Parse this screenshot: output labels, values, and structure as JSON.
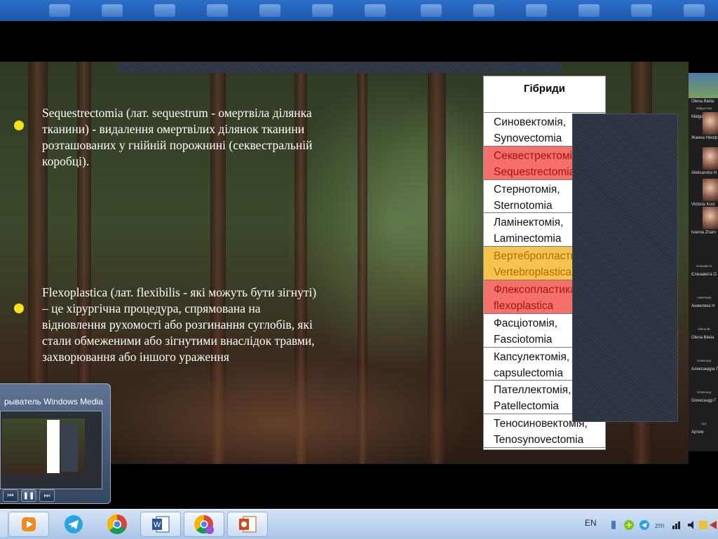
{
  "slide": {
    "bullets": [
      {
        "text": "Sequestrectomia (лат. sequestrum - омертвіла ділянка тканини) - видалення омертвілих ділянок тканини розташованих у гнійній порожнині (секвестральній коробці)."
      },
      {
        "text": "Flexoplastica (лат. flexibilis - які можуть бути зігнуті) – це хірургічна процедура, спрямована на відновлення рухомості або розгинання суглобів, які стали обмеженими або зігнутими внаслідок травми, захворювання або іншого ураження"
      }
    ],
    "bullet_color": "#f5e21a",
    "table": {
      "header": "Гібриди",
      "rows": [
        {
          "line1": "Синовектомія,",
          "line2": "Synovectomia",
          "highlight": "none"
        },
        {
          "line1": "Секвестректомія,",
          "line2": "Sequestrectomia",
          "highlight": "red"
        },
        {
          "line1": "Стернотомія,",
          "line2": "Sternotomia",
          "highlight": "none"
        },
        {
          "line1": "Ламінектомія,",
          "line2": "Laminectomia",
          "highlight": "none"
        },
        {
          "line1": "Вертебропластика,",
          "line2": "Vertebroplastica",
          "highlight": "yellow"
        },
        {
          "line1": "Флексопластика,",
          "line2": "flexoplastica",
          "highlight": "red"
        },
        {
          "line1": "Фасціотомія,",
          "line2": "Fasciotomia",
          "highlight": "none"
        },
        {
          "line1": "Капсулектомія,",
          "line2": "capsulectomia",
          "highlight": "none"
        },
        {
          "line1": "Пателлектомія,",
          "line2": "Patellectomia",
          "highlight": "none"
        },
        {
          "line1": "Теносиновектомія,",
          "line2": "Tenosynovectomia",
          "highlight": "none"
        }
      ],
      "colors": {
        "red": "#f4706a",
        "yellow": "#f7c34f"
      }
    }
  },
  "participants": {
    "items": [
      {
        "header": "",
        "name": "Olena Bielia",
        "has_video": true
      },
      {
        "header": "Malgorzata",
        "name": "Malgorzata J",
        "has_video": false
      },
      {
        "header": "",
        "name": "Жанна Нікоф",
        "has_video": true
      },
      {
        "header": "",
        "name": "Aleksandra H",
        "has_video": true
      },
      {
        "header": "",
        "name": "Victoria Kost",
        "has_video": true
      },
      {
        "header": "",
        "name": "Ivanna Zham",
        "has_video": true
      },
      {
        "header": "Єлизавета",
        "name": "Єлизавета О",
        "has_video": false
      },
      {
        "header": "Анжелика",
        "name": "Анжелика Н",
        "has_video": false
      },
      {
        "header": "Olena Bi",
        "name": "Olena Bielia",
        "has_video": false
      },
      {
        "header": "Александ",
        "name": "Александра Л",
        "has_video": false
      },
      {
        "header": "Олександ",
        "name": "Олександр Г",
        "has_video": false
      },
      {
        "header": "Арт",
        "name": "Артем",
        "has_video": false
      }
    ]
  },
  "media_player": {
    "title": "рыватель Windows Media",
    "controls": [
      {
        "icon": "previous-icon",
        "glyph": "⏮"
      },
      {
        "icon": "pause-icon",
        "glyph": "❚❚"
      },
      {
        "icon": "next-icon",
        "glyph": "⏭"
      }
    ]
  },
  "taskbar": {
    "apps": [
      {
        "name": "media-player-taskbar-button",
        "icon": "media-player-icon",
        "active": true
      },
      {
        "name": "telegram-taskbar-button",
        "icon": "telegram-icon",
        "active": false
      },
      {
        "name": "chrome-taskbar-button",
        "icon": "chrome-icon",
        "active": false
      },
      {
        "name": "word-taskbar-button",
        "icon": "word-icon",
        "active": true
      },
      {
        "name": "chrome-profile-taskbar-button",
        "icon": "chrome-profile-icon",
        "active": true
      },
      {
        "name": "powerpoint-taskbar-button",
        "icon": "powerpoint-icon",
        "active": true
      }
    ],
    "language": "EN",
    "tray": [
      "usb-icon",
      "plus-icon",
      "telegram-tray-icon",
      "zoom-tray-icon",
      "network-icon",
      "volume-icon",
      "action-center-icon",
      "power-icon"
    ]
  }
}
